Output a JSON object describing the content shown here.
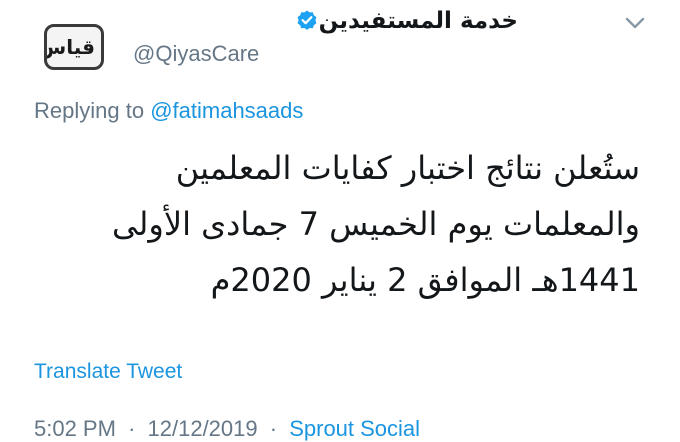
{
  "author": {
    "display_name": "خدمة المستفيدين",
    "handle": "@QiyasCare",
    "verified": true,
    "avatar_text": "قياس"
  },
  "reply": {
    "prefix": "Replying to",
    "to_handle": "@fatimahsaads"
  },
  "tweet": {
    "lines": [
      "ستُعلن نتائج اختبار كفايات المعلمين",
      "والمعلمات يوم الخميس 7 جمادى الأولى",
      "1441هـ الموافق 2 يناير 2020م"
    ]
  },
  "actions": {
    "translate_label": "Translate Tweet"
  },
  "meta": {
    "time": "5:02 PM",
    "date": "12/12/2019",
    "separator": "·",
    "source": "Sprout Social"
  },
  "colors": {
    "link": "#1b95e0",
    "muted": "#657786",
    "text": "#14171a",
    "verified": "#1da1f2"
  },
  "icons": {
    "menu": "chevron-down-icon",
    "verified": "verified-badge-icon"
  }
}
